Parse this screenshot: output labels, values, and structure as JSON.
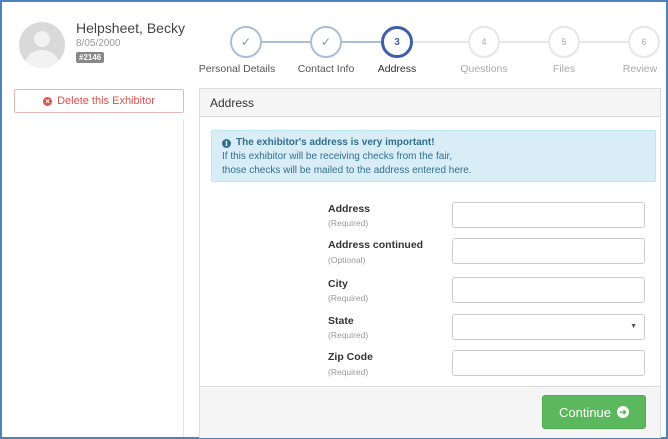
{
  "profile": {
    "name": "Helpsheet, Becky",
    "dob": "8/05/2000",
    "id_badge": "#2146"
  },
  "sidebar": {
    "delete_label": "Delete this Exhibitor"
  },
  "stepper": {
    "steps": [
      {
        "number": "1",
        "label": "Personal Details",
        "state": "done",
        "icon": "check-icon"
      },
      {
        "number": "2",
        "label": "Contact Info",
        "state": "done",
        "icon": "check-icon"
      },
      {
        "number": "3",
        "label": "Address",
        "state": "active"
      },
      {
        "number": "4",
        "label": "Questions",
        "state": "todo"
      },
      {
        "number": "5",
        "label": "Files",
        "state": "todo"
      },
      {
        "number": "6",
        "label": "Review",
        "state": "todo"
      }
    ],
    "colors": {
      "done": "#a9bfd9",
      "active": "#3f5fa7",
      "todo": "#e6e6e6"
    }
  },
  "panel": {
    "title": "Address",
    "alert": {
      "title": "The exhibitor's address is very important!",
      "line1": "If this exhibitor will be receiving checks from the fair,",
      "line2": "those checks will be mailed to the address entered here."
    },
    "fields": [
      {
        "label": "Address",
        "hint": "(Required)",
        "value": "",
        "type": "text"
      },
      {
        "label": "Address continued",
        "hint": "(Optional)",
        "value": "",
        "type": "text"
      },
      {
        "label": "City",
        "hint": "(Required)",
        "value": "",
        "type": "text"
      },
      {
        "label": "State",
        "hint": "(Required)",
        "value": "",
        "type": "select"
      },
      {
        "label": "Zip Code",
        "hint": "(Required)",
        "value": "",
        "type": "text"
      }
    ],
    "continue_label": "Continue"
  },
  "colors": {
    "accent_blue": "#3f5fa7",
    "success_green": "#5cb85c",
    "danger_red": "#d9534f",
    "info_bg": "#d9edf7"
  }
}
